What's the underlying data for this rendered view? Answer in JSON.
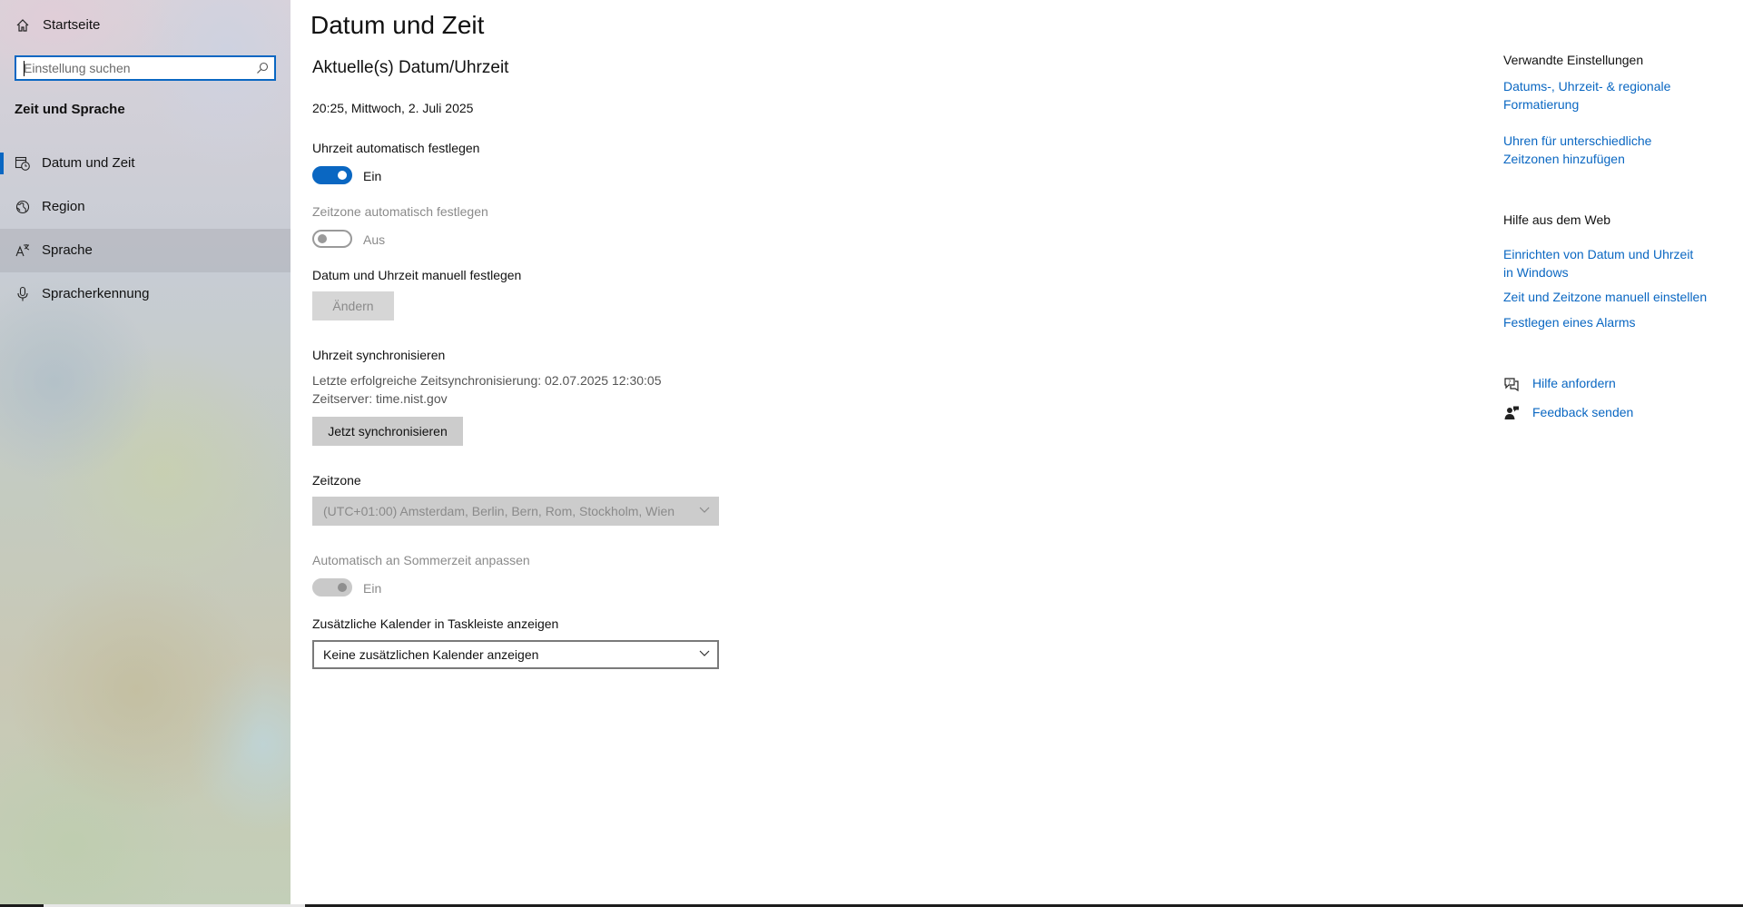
{
  "sidebar": {
    "home_label": "Startseite",
    "search_placeholder": "Einstellung suchen",
    "section_title": "Zeit und Sprache",
    "items": [
      {
        "label": "Datum und Zeit",
        "icon": "datetime-icon"
      },
      {
        "label": "Region",
        "icon": "globe-icon"
      },
      {
        "label": "Sprache",
        "icon": "language-icon"
      },
      {
        "label": "Spracherkennung",
        "icon": "microphone-icon"
      }
    ]
  },
  "main": {
    "title": "Datum und Zeit",
    "current_heading": "Aktuelle(s) Datum/Uhrzeit",
    "current_value": "20:25, Mittwoch, 2. Juli 2025",
    "auto_time": {
      "label": "Uhrzeit automatisch festlegen",
      "state": "Ein",
      "on": true
    },
    "auto_timezone": {
      "label": "Zeitzone automatisch festlegen",
      "state": "Aus",
      "on": false,
      "disabled": true
    },
    "manual": {
      "label": "Datum und Uhrzeit manuell festlegen",
      "button": "Ändern",
      "disabled": true
    },
    "sync": {
      "heading": "Uhrzeit synchronisieren",
      "last_sync": "Letzte erfolgreiche Zeitsynchronisierung: 02.07.2025 12:30:05",
      "server": "Zeitserver: time.nist.gov",
      "button": "Jetzt synchronisieren"
    },
    "timezone": {
      "label": "Zeitzone",
      "value": "(UTC+01:00) Amsterdam, Berlin, Bern, Rom, Stockholm, Wien",
      "disabled": true
    },
    "dst": {
      "label": "Automatisch an Sommerzeit anpassen",
      "state": "Ein",
      "on": true,
      "disabled": true
    },
    "calendar": {
      "label": "Zusätzliche Kalender in Taskleiste anzeigen",
      "value": "Keine zusätzlichen Kalender anzeigen"
    }
  },
  "related": {
    "heading": "Verwandte Einstellungen",
    "links": [
      [
        "Datums-, Uhrzeit- & regionale",
        "Formatierung"
      ],
      [
        "Uhren für unterschiedliche",
        "Zeitzonen hinzufügen"
      ]
    ]
  },
  "web_help": {
    "heading": "Hilfe aus dem Web",
    "links": [
      [
        "Einrichten von Datum und Uhrzeit",
        "in Windows"
      ],
      [
        "Zeit und Zeitzone manuell einstellen"
      ],
      [
        "Festlegen eines Alarms"
      ]
    ]
  },
  "actions": {
    "help": {
      "label": "Hilfe anfordern",
      "icon": "help-chat-icon"
    },
    "feedback": {
      "label": "Feedback senden",
      "icon": "feedback-icon"
    }
  },
  "colors": {
    "accent": "#0a67c2",
    "disabled_text": "#8a8a8a",
    "button_bg": "#cccccc"
  }
}
